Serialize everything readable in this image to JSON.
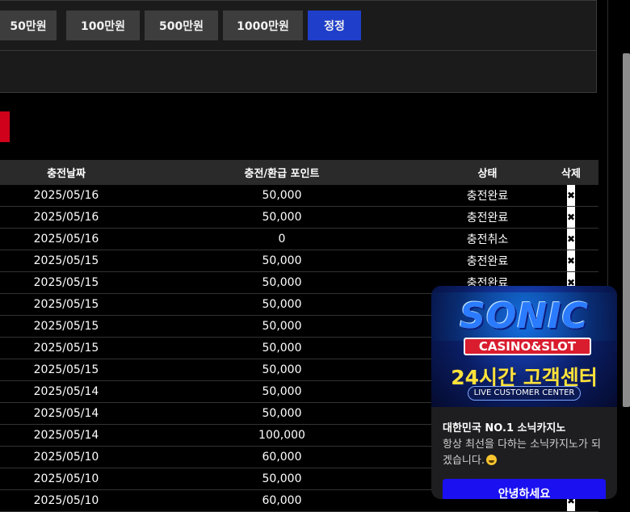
{
  "amount_buttons": [
    "50만원",
    "100만원",
    "500만원",
    "1000만원",
    "정정"
  ],
  "table": {
    "headers": [
      "충전날짜",
      "충전/환급 포인트",
      "상태",
      "삭제"
    ],
    "delete_symbol": "✖",
    "rows": [
      {
        "date": "2025/05/16",
        "points": "50,000",
        "status": "충전완료"
      },
      {
        "date": "2025/05/16",
        "points": "50,000",
        "status": "충전완료"
      },
      {
        "date": "2025/05/16",
        "points": "0",
        "status": "충전취소"
      },
      {
        "date": "2025/05/15",
        "points": "50,000",
        "status": "충전완료"
      },
      {
        "date": "2025/05/15",
        "points": "50,000",
        "status": "충전완료"
      },
      {
        "date": "2025/05/15",
        "points": "50,000",
        "status": ""
      },
      {
        "date": "2025/05/15",
        "points": "50,000",
        "status": ""
      },
      {
        "date": "2025/05/15",
        "points": "50,000",
        "status": ""
      },
      {
        "date": "2025/05/15",
        "points": "50,000",
        "status": ""
      },
      {
        "date": "2025/05/14",
        "points": "50,000",
        "status": ""
      },
      {
        "date": "2025/05/14",
        "points": "50,000",
        "status": ""
      },
      {
        "date": "2025/05/14",
        "points": "100,000",
        "status": ""
      },
      {
        "date": "2025/05/10",
        "points": "60,000",
        "status": ""
      },
      {
        "date": "2025/05/10",
        "points": "50,000",
        "status": ""
      },
      {
        "date": "2025/05/10",
        "points": "60,000",
        "status": ""
      }
    ]
  },
  "popup": {
    "banner": {
      "brand": "SONIC",
      "badge": "CASINO&SLOT",
      "headline": "24시간 고객센터",
      "pill": "LIVE CUSTOMER CENTER"
    },
    "title": "대한민국 NO.1 소닉카지노",
    "body": "항상 최선을 다하는 소닉카지노가 되겠습니다.",
    "button": "안녕하세요"
  },
  "colors": {
    "primary_button": "#1f3ec9",
    "accent_red": "#d0021b",
    "popup_button": "#1a10f0"
  }
}
